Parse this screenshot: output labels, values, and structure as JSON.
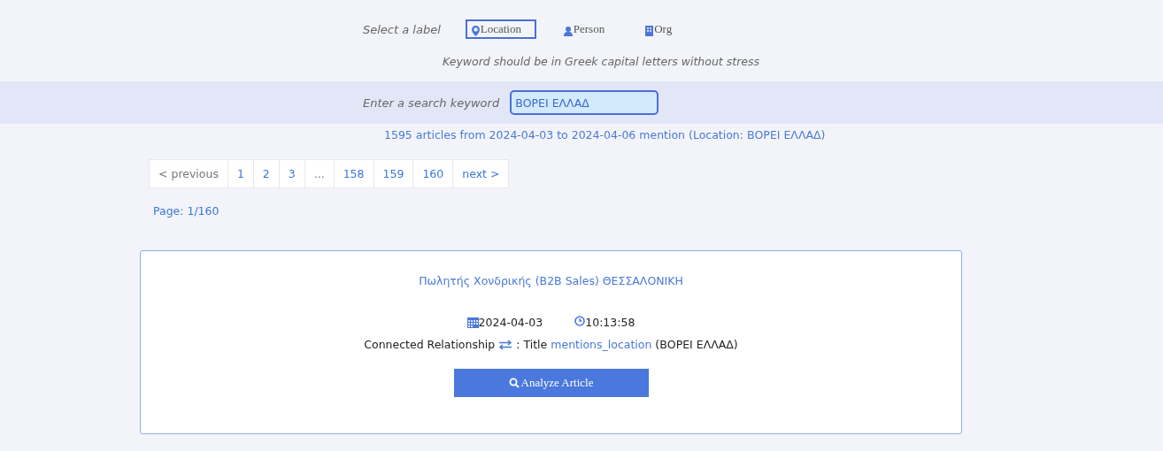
{
  "label_picker": {
    "prompt": "Select a label",
    "labels": [
      {
        "kind": "location",
        "label": "Location",
        "selected": true
      },
      {
        "kind": "person",
        "label": "Person",
        "selected": false
      },
      {
        "kind": "org",
        "label": "Org",
        "selected": false
      }
    ],
    "hint": "Keyword should be in Greek capital letters without stress"
  },
  "search": {
    "label": "Enter a search keyword",
    "value": "ΒΟΡΕΙ ΕΛΛΑΔ"
  },
  "summary": "1595 articles from 2024-04-03 to 2024-04-06 mention (Location: ΒΟΡΕΙ ΕΛΛΑΔ)",
  "pagination": [
    {
      "kind": "prev",
      "label": "< previous"
    },
    {
      "kind": "page",
      "label": "1"
    },
    {
      "kind": "page",
      "label": "2"
    },
    {
      "kind": "page",
      "label": "3"
    },
    {
      "kind": "ellipsis",
      "label": "..."
    },
    {
      "kind": "page",
      "label": "158"
    },
    {
      "kind": "page",
      "label": "159"
    },
    {
      "kind": "page",
      "label": "160"
    },
    {
      "kind": "next",
      "label": "next >"
    }
  ],
  "page_indicator": "Page: 1/160",
  "articles": [
    {
      "title": "Πωλητής Χονδρικής (B2B Sales) ΘΕΣΣΑΛΟΝΙΚΗ",
      "date": "2024-04-03",
      "time": "10:13:58",
      "relationship_label": "Connected Relationship",
      "relationship_sep": ": Title",
      "relationship": "mentions_location",
      "entity": "(ΒΟΡΕΙ ΕΛΛΑΔ)",
      "button": "Analyze Article"
    }
  ]
}
